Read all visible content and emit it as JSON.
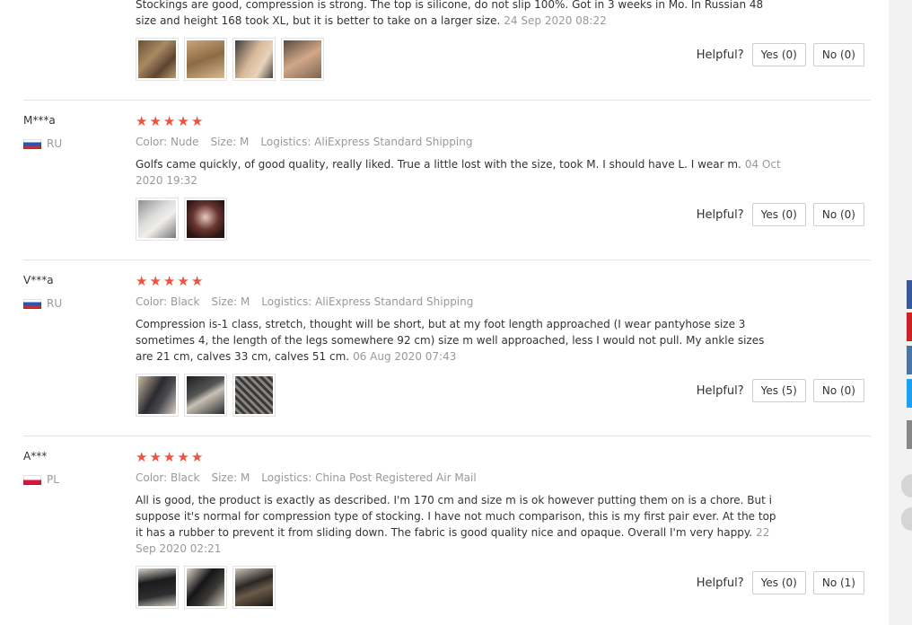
{
  "helpful_label": "Helpful?",
  "reviews": [
    {
      "name": "",
      "country": "",
      "text": "Stockings are good, compression is strong. The top is silicone, do not slip 100%. Got in 3 weeks in Mo. In Russian 48 size and height 168 took XL, but it is better to take on a larger size.",
      "date": "24 Sep 2020 08:22",
      "yes": "Yes (0)",
      "no": "No (0)",
      "photo_count": 4
    },
    {
      "name": "M***a",
      "country": "RU",
      "rating": 5,
      "color": "Color: Nude",
      "size": "Size: M",
      "logistics": "Logistics: AliExpress Standard Shipping",
      "text": "Golfs came quickly, of good quality, really liked. True a little lost with the size, took M. I should have L. I wear m.",
      "date": "04 Oct 2020 19:32",
      "yes": "Yes (0)",
      "no": "No (0)",
      "photo_count": 2
    },
    {
      "name": "V***a",
      "country": "RU",
      "rating": 5,
      "color": "Color: Black",
      "size": "Size: M",
      "logistics": "Logistics: AliExpress Standard Shipping",
      "text": "Compression is-1 class, stretch, thought will be short, but at my foot length approached (I wear pantyhose size 3 sometimes 4, the length of the legs somewhere 92 cm) size m well approached, less I would not pull. My ankle sizes are 21 cm, calves 33 cm, calves 51 cm.",
      "date": "06 Aug 2020 07:43",
      "yes": "Yes (5)",
      "no": "No (0)",
      "photo_count": 3
    },
    {
      "name": "A***",
      "country": "PL",
      "rating": 5,
      "color": "Color: Black",
      "size": "Size: M",
      "logistics": "Logistics: China Post Registered Air Mail",
      "text": "All is good, the product is exactly as described. I'm 170 cm and size m is ok however putting them on is a chore. But i suppose it's normal for compression type of stocking. I have not much comparison, this is my first pair ever. At the top it has a rubber to prevent it from sliding down. The fabric is good quality nice and opaque. Overall I'm very happy.",
      "date": "22 Sep 2020 02:21",
      "yes": "Yes (0)",
      "no": "No (1)",
      "photo_count": 3
    }
  ],
  "social_colors": [
    "#3b5998",
    "#cc2127",
    "#4c75a3",
    "#1da1f2",
    "#888888"
  ]
}
